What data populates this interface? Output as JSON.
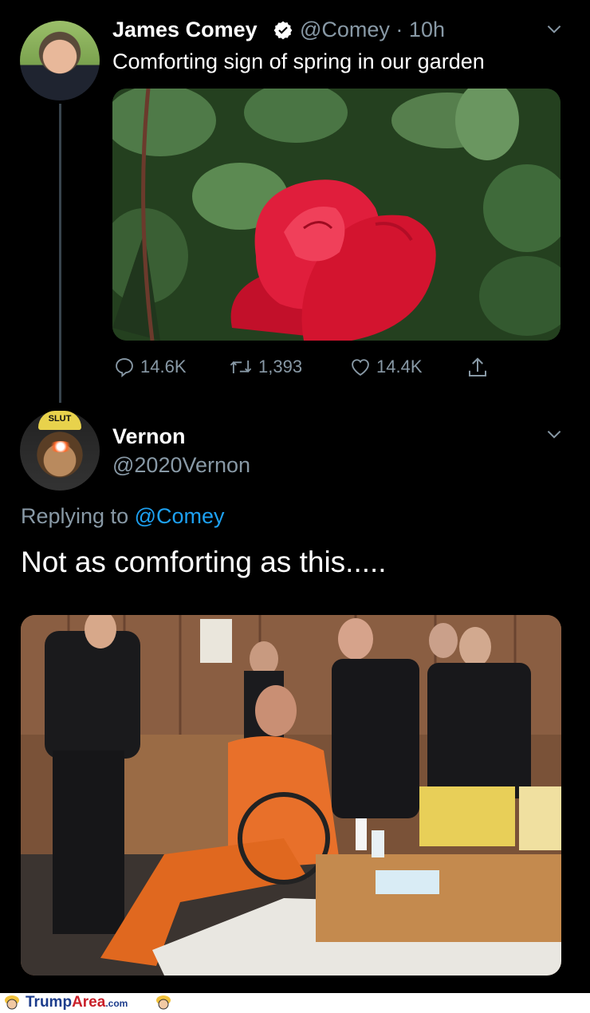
{
  "tweet1": {
    "author_name": "James Comey",
    "handle_time": "@Comey · 10h",
    "text": "Comforting sign of spring in our garden",
    "avatar_icon": "profile-photo",
    "verified_icon": "verified-badge-icon",
    "actions": {
      "reply_count": "14.6K",
      "retweet_count": "1,393",
      "like_count": "14.4K"
    }
  },
  "tweet2": {
    "author_name": "Vernon",
    "handle": "@2020Vernon",
    "replying_prefix": "Replying to",
    "replying_mention": "@Comey",
    "text": "Not as comforting as this.....",
    "avatar_hat_text": "SLUT"
  },
  "footer": {
    "brand_main": "Trump",
    "brand_accent": "Area",
    "brand_suffix": ".com"
  },
  "colors": {
    "background": "#000000",
    "muted": "#8899a6",
    "link": "#1da1f2",
    "thread_line": "#38444d"
  }
}
